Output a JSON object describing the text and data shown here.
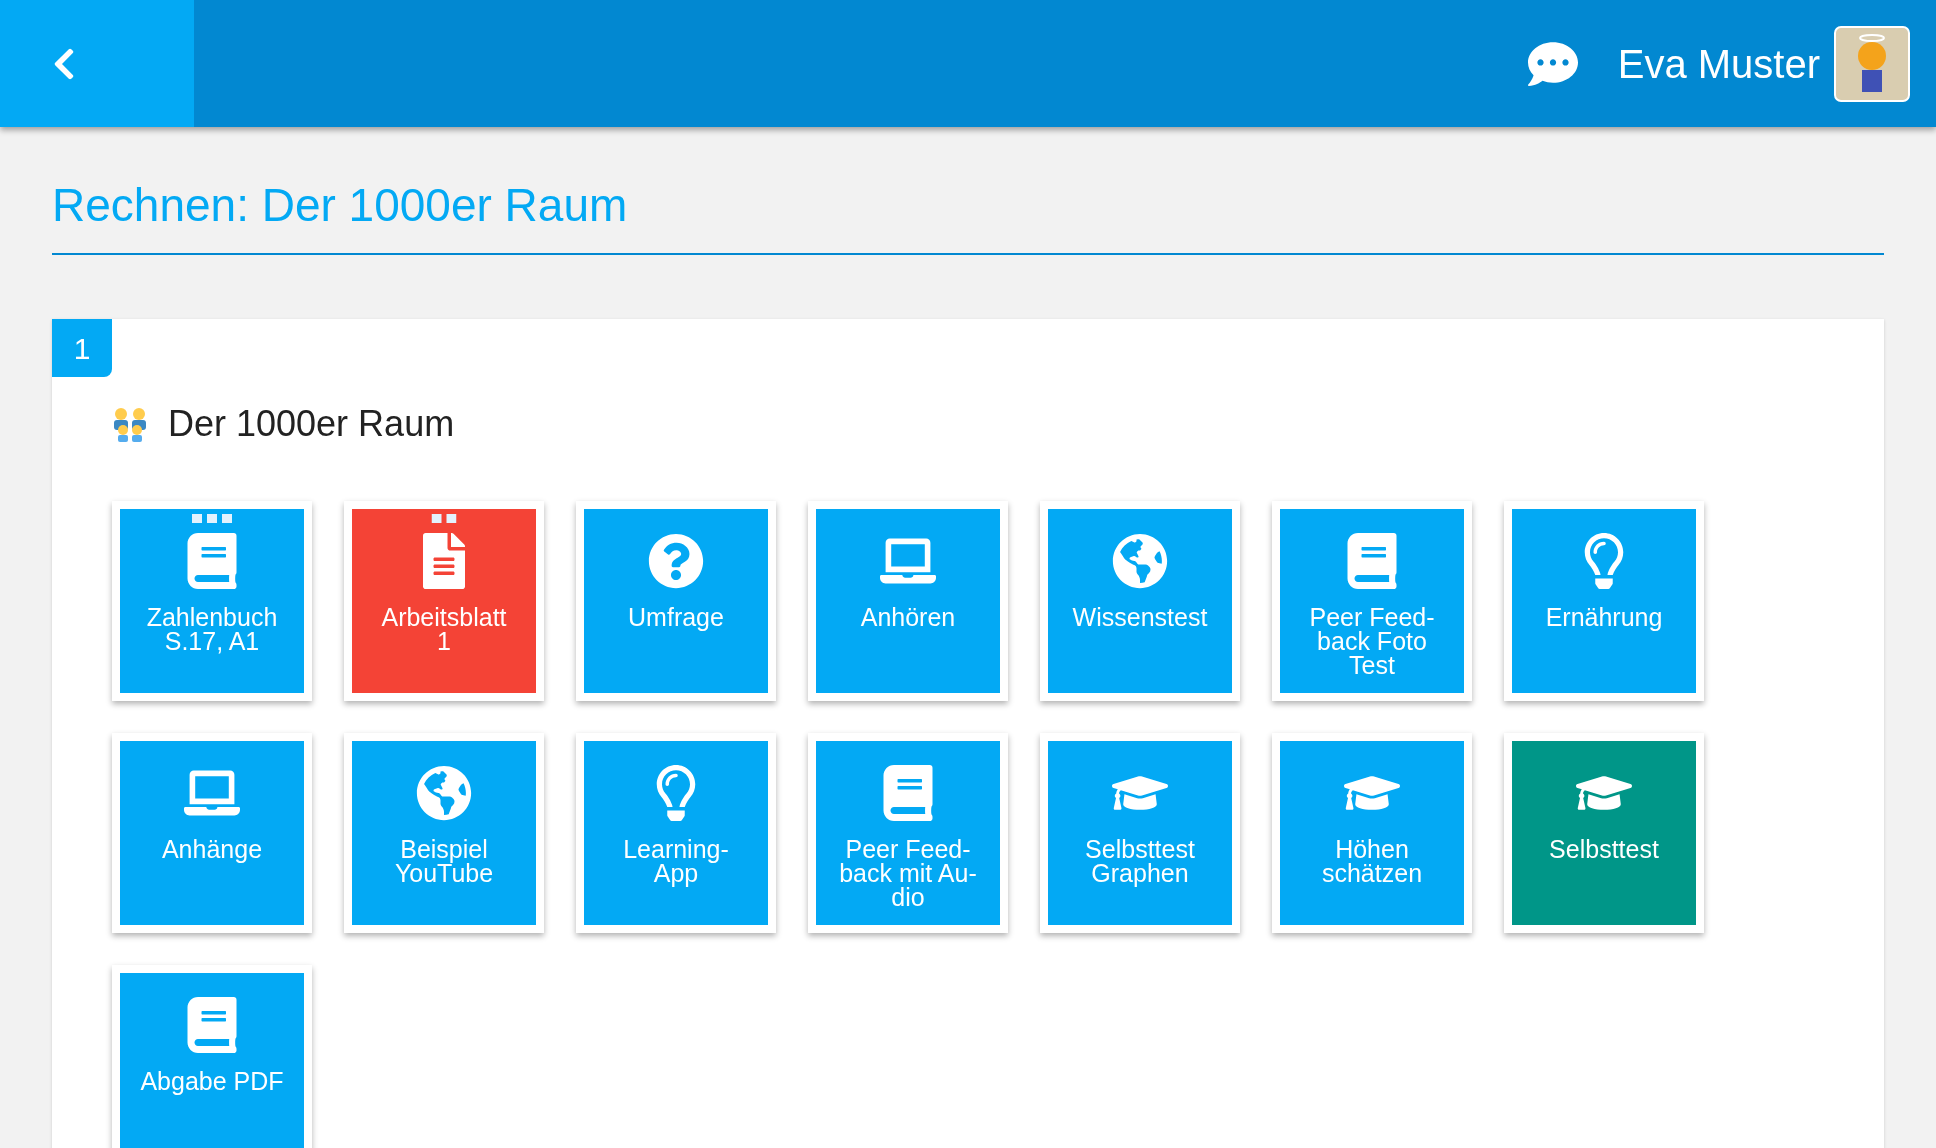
{
  "header": {
    "user_name": "Eva Muster"
  },
  "page_title": "Rechnen: Der 1000er Raum",
  "section": {
    "number": "1",
    "title": "Der 1000er Raum",
    "tiles": [
      {
        "kind": "book",
        "lines": [
          "Zahlenbuch",
          "S.17, A1"
        ],
        "color": "#03a9f4",
        "marker": {
          "kind": "three-dots"
        }
      },
      {
        "kind": "document",
        "lines": [
          "Arbeitsblatt",
          "1"
        ],
        "color": "#f44336",
        "marker": {
          "kind": "two-dots"
        }
      },
      {
        "kind": "question",
        "lines": [
          "Umfrage"
        ],
        "color": "#03a9f4"
      },
      {
        "kind": "laptop",
        "lines": [
          "Anhören"
        ],
        "color": "#03a9f4"
      },
      {
        "kind": "globe",
        "lines": [
          "Wissenstest"
        ],
        "color": "#03a9f4"
      },
      {
        "kind": "book",
        "lines": [
          "Peer Feed-",
          "back Foto",
          "Test"
        ],
        "color": "#03a9f4"
      },
      {
        "kind": "bulb",
        "lines": [
          "Ernährung"
        ],
        "color": "#03a9f4"
      },
      {
        "kind": "laptop",
        "lines": [
          "Anhänge"
        ],
        "color": "#03a9f4"
      },
      {
        "kind": "globe",
        "lines": [
          "Beispiel",
          "YouTube"
        ],
        "color": "#03a9f4"
      },
      {
        "kind": "bulb",
        "lines": [
          "Learning-",
          "App"
        ],
        "color": "#03a9f4"
      },
      {
        "kind": "book",
        "lines": [
          "Peer Feed-",
          "back mit Au-",
          "dio"
        ],
        "color": "#03a9f4"
      },
      {
        "kind": "cap",
        "lines": [
          "Selbsttest",
          "Graphen"
        ],
        "color": "#03a9f4"
      },
      {
        "kind": "cap",
        "lines": [
          "Höhen",
          "schätzen"
        ],
        "color": "#03a9f4"
      },
      {
        "kind": "cap",
        "lines": [
          "Selbsttest"
        ],
        "color": "#009688"
      },
      {
        "kind": "book",
        "lines": [
          "Abgabe PDF"
        ],
        "color": "#03a9f4"
      }
    ]
  }
}
